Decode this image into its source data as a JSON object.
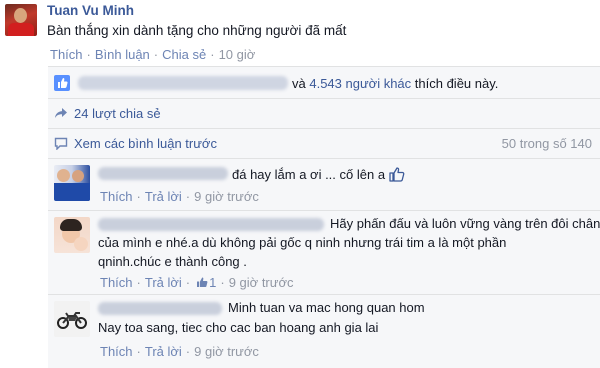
{
  "post": {
    "author": "Tuan Vu Minh",
    "text": "Bàn thắng xin dành tặng cho những người đã mất",
    "actions": {
      "like": "Thích",
      "comment": "Bình luận",
      "share": "Chia sẻ",
      "time": "10 giờ"
    }
  },
  "likes": {
    "connector": "và",
    "count_text": "4.543 người khác",
    "suffix": "thích điều này."
  },
  "shares": {
    "text": "24 lượt chia sẻ"
  },
  "more_comments": {
    "label": "Xem các bình luận trước",
    "pager": "50 trong số 140"
  },
  "comments": [
    {
      "lines": [
        "đá hay lắm a ơi ... cố lên a"
      ],
      "like_label": "Thích",
      "reply_label": "Trả lời",
      "time": "9 giờ trước"
    },
    {
      "lines": [
        "Hãy phấn đấu và luôn vững vàng trên đôi chân",
        "của mình e nhé.a dù không pải gốc q ninh nhưng trái tim a là một phần",
        "qninh.chúc e thành công ."
      ],
      "like_label": "Thích",
      "reply_label": "Trả lời",
      "like_count": "1",
      "time": "9 giờ trước"
    },
    {
      "lines": [
        "Minh tuan va mac hong quan hom",
        "Nay toa sang, tiec cho cac ban hoang anh gia lai"
      ],
      "like_label": "Thích",
      "reply_label": "Trả lời",
      "time": "9 giờ trước"
    }
  ],
  "colors": {
    "link": "#3b5998",
    "muted": "#9197a3",
    "action": "#6d84b4",
    "panel": "#f6f7f9",
    "border": "#e1e2e3"
  },
  "icons": [
    "thumbs-up-icon",
    "share-icon",
    "comment-bubble-icon"
  ]
}
